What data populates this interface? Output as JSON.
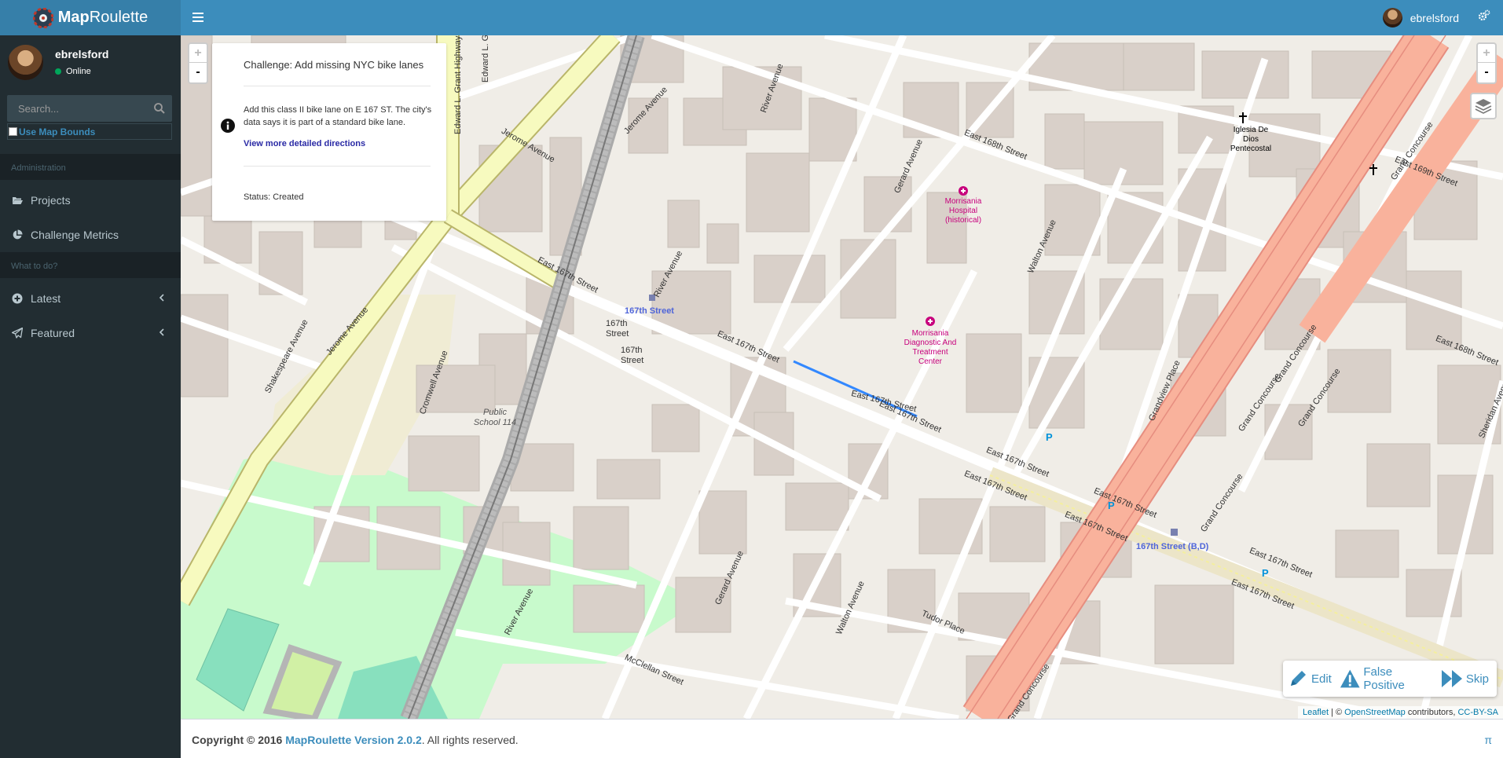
{
  "header": {
    "brand_bold": "Map",
    "brand_rest": "Roulette",
    "username": "ebrelsford"
  },
  "sidebar": {
    "username": "ebrelsford",
    "status": "Online",
    "search_placeholder": "Search...",
    "use_map_bounds": "Use Map Bounds",
    "section_admin": "Administration",
    "section_todo": "What to do?",
    "items": [
      {
        "label": "Projects",
        "icon": "folder-open-icon"
      },
      {
        "label": "Challenge Metrics",
        "icon": "pie-chart-icon"
      },
      {
        "label": "Latest",
        "icon": "plus-circle-icon"
      },
      {
        "label": "Featured",
        "icon": "paper-plane-icon"
      }
    ]
  },
  "challenge": {
    "title": "Challenge: Add missing NYC bike lanes",
    "instructions": "Add this class II bike lane on E 167 ST. The city's data says it is part of a standard bike lane.",
    "directions_link": "View more detailed directions",
    "status": "Status: Created"
  },
  "task_controls": {
    "edit": "Edit",
    "false_positive": "False Positive",
    "skip": "Skip"
  },
  "map": {
    "zoom_in": "+",
    "zoom_out": "-",
    "attribution_leaflet": "Leaflet",
    "attribution_sep": " | © ",
    "attribution_osm": "OpenStreetMap",
    "attribution_mid": " contributors, ",
    "attribution_license": "CC-BY-SA",
    "labels": {
      "jerome_ave_1": "Jerome Avenue",
      "jerome_ave_2": "Jerome Avenue",
      "jerome_ave_3": "Jerome Avenue",
      "grant_hwy": "Edward L. Grant Highway",
      "edward_l": "Edward L. G",
      "e167_1": "East 167th Street",
      "e167_2": "East 167th Street",
      "e167_3": "East 167th Street",
      "e167_4": "East 167th Street",
      "e167_5": "East 167th Street",
      "e167_6": "East 167th Street",
      "e167_7": "East 167th Street",
      "e167_8": "East 167th Street",
      "e167_9": "East 167th Street",
      "e167_10": "East 167th Street",
      "e168": "East 168th Street",
      "e168_b": "East 168th Street",
      "e169": "East 169th Street",
      "river_ave_1": "River Avenue",
      "river_ave_2": "River Avenue",
      "river_ave_3": "River Avenue",
      "gerard_1": "Gerard Avenue",
      "gerard_2": "Gerard Avenue",
      "walton_1": "Walton Avenue",
      "walton_2": "Walton Avenue",
      "grandview": "Grandview Place",
      "grand_concourse_1": "Grand Concourse",
      "grand_concourse_2": "Grand Concourse",
      "grand_concourse_3": "Grand Concourse",
      "grand_concourse_4": "Grand Concourse",
      "grand_concourse_5": "Grand Concourse",
      "grand_concourse_6": "Grand Concourse",
      "cromwell": "Cromwell Avenue",
      "shakespeare": "Shakespeare Avenue",
      "tudor": "Tudor Place",
      "mcclellan": "McClellan Street",
      "sheridan": "Sheridan Avenue",
      "school": "Public School 114",
      "station_1": "167th Street",
      "station_2": "167th Street (B,D)",
      "station_stop_a": "167th Street",
      "station_stop_b": "167th Street",
      "hospital_1": "Morrisania Hospital (historical)",
      "hospital_2": "Morrisania Diagnostic And Treatment Center",
      "church": "Iglesia De Dios Pentecostal"
    }
  },
  "footer": {
    "copyright": "Copyright © 2016 ",
    "version": "MapRoulette Version 2.0.2",
    "rights": ". All rights reserved.",
    "pi": "π"
  },
  "colors": {
    "header": "#3c8dbc",
    "logo_bg": "#367fa9",
    "sidebar": "#222d32",
    "map_bg": "#f0ede7",
    "building": "#d9d0c9",
    "primary_road": "#fcd6a4",
    "trunk_road": "#f9b29c",
    "secondary_road": "#f7fabf",
    "park": "#c8facc",
    "bike_lane": "#3388ff"
  }
}
